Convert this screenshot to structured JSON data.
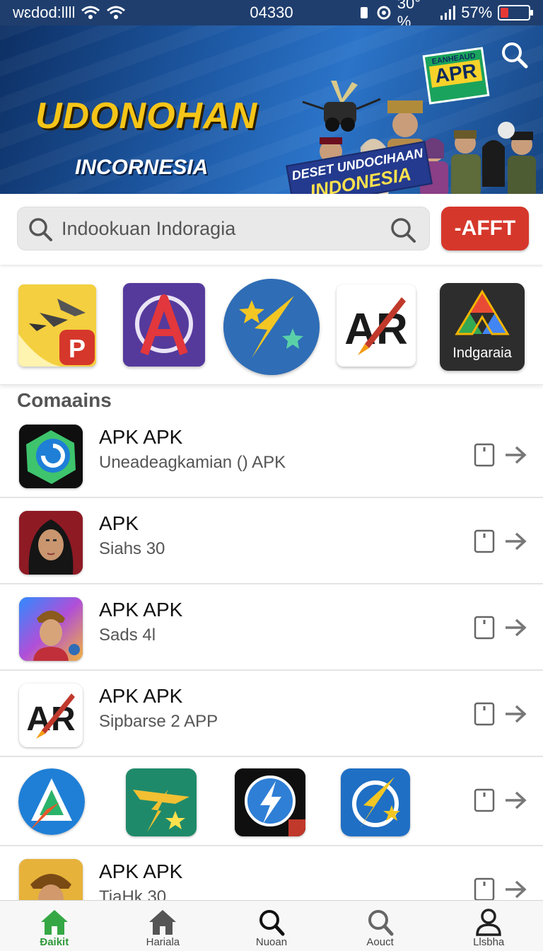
{
  "status_bar": {
    "carrier": "wɛdod:llll",
    "time": "04330",
    "battery_text": "30°%",
    "signal_text": "57%",
    "battery_level": 0.3
  },
  "banner": {
    "title": "UDONOHAN",
    "subtitle": "INCORNESIA",
    "badge_top": "ΕΑΝΗΕΑUD",
    "badge_main": "APR",
    "ribbon_line1": "DESET UNDOCIHAAN",
    "ribbon_line2": "INDONESIA"
  },
  "search": {
    "placeholder": "Indookuan Indoragia",
    "button_label": "-AFFT"
  },
  "featured": {
    "items": [
      {
        "icon": "plane-app-icon"
      },
      {
        "icon": "a-logo-app-icon"
      },
      {
        "icon": "star-bolt-app-icon"
      },
      {
        "icon": "apr-rocket-app-icon"
      },
      {
        "icon": "indgaraia-app-icon",
        "label": "Indgaraia"
      }
    ]
  },
  "section": {
    "title": "Comaains"
  },
  "list": [
    {
      "title": "APK APK",
      "subtitle": "Uneadeagkamian () APK",
      "icon": "green-bubble-app-icon"
    },
    {
      "title": "APK",
      "subtitle": "Siahs 30",
      "icon": "woman-portrait-app-icon"
    },
    {
      "title": "APK APK",
      "subtitle": "Sads 4l",
      "icon": "boy-portrait-app-icon"
    },
    {
      "title": "APK APK",
      "subtitle": "Sipbarse 2 APP",
      "icon": "apr-rocket-app-icon"
    },
    {
      "title": "",
      "subtitle": "",
      "icon": "icon-strip"
    },
    {
      "title": "APK APK",
      "subtitle": "TiaHk 30",
      "icon": "man-portrait-app-icon"
    }
  ],
  "bottom_nav": [
    {
      "label": "Ɖaikit",
      "icon": "home-icon",
      "active": true
    },
    {
      "label": "Hariala",
      "icon": "home-icon",
      "active": false
    },
    {
      "label": "Nuoan",
      "icon": "search-icon",
      "active": false
    },
    {
      "label": "Aouct",
      "icon": "search-icon",
      "active": false
    },
    {
      "label": "Llsbha",
      "icon": "user-icon",
      "active": false
    }
  ],
  "colors": {
    "accent_red": "#d6372b",
    "nav_active": "#2e9a3a",
    "banner_gold": "#f5c518"
  }
}
